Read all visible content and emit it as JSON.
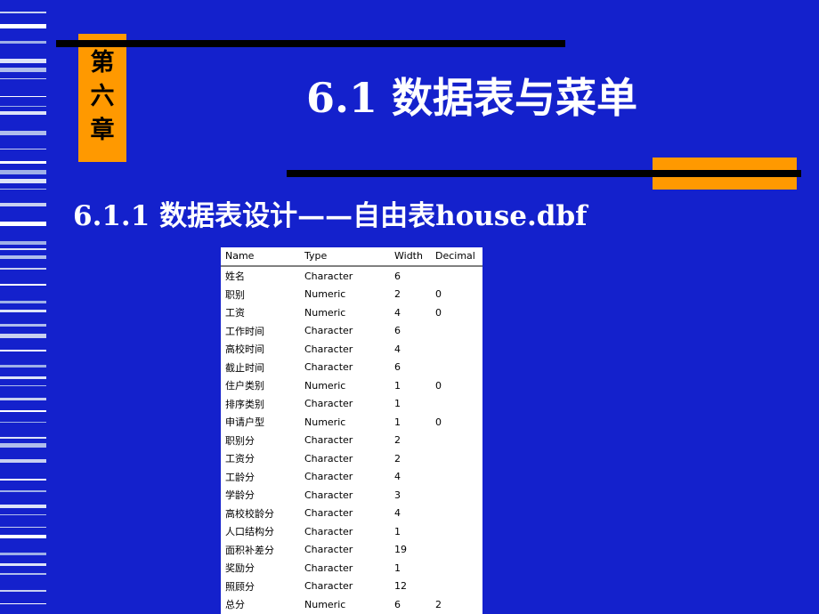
{
  "slide": {
    "chapter_badge": [
      "第",
      "六",
      "章"
    ],
    "title": "6.1 数据表与菜单",
    "subtitle": "6.1.1 数据表设计——自由表house.dbf"
  },
  "colors": {
    "background_blue": "#1421cc",
    "accent_orange": "#ff9900",
    "bar_black": "#000000",
    "table_background": "#ffffff",
    "title_text": "#ffffff"
  },
  "table": {
    "headers": [
      "Name",
      "Type",
      "Width",
      "Decimal"
    ],
    "rows": [
      {
        "name": "姓名",
        "type": "Character",
        "width": "6",
        "decimal": ""
      },
      {
        "name": "职别",
        "type": "Numeric",
        "width": "2",
        "decimal": "0"
      },
      {
        "name": "工资",
        "type": "Numeric",
        "width": "4",
        "decimal": "0"
      },
      {
        "name": "工作时间",
        "type": "Character",
        "width": "6",
        "decimal": ""
      },
      {
        "name": "高校时间",
        "type": "Character",
        "width": "4",
        "decimal": ""
      },
      {
        "name": "截止时间",
        "type": "Character",
        "width": "6",
        "decimal": ""
      },
      {
        "name": "住户类别",
        "type": "Numeric",
        "width": "1",
        "decimal": "0"
      },
      {
        "name": "排序类别",
        "type": "Character",
        "width": "1",
        "decimal": ""
      },
      {
        "name": "申请户型",
        "type": "Numeric",
        "width": "1",
        "decimal": "0"
      },
      {
        "name": "职别分",
        "type": "Character",
        "width": "2",
        "decimal": ""
      },
      {
        "name": "工资分",
        "type": "Character",
        "width": "2",
        "decimal": ""
      },
      {
        "name": "工龄分",
        "type": "Character",
        "width": "4",
        "decimal": ""
      },
      {
        "name": "学龄分",
        "type": "Character",
        "width": "3",
        "decimal": ""
      },
      {
        "name": "高校校龄分",
        "type": "Character",
        "width": "4",
        "decimal": ""
      },
      {
        "name": "人口结构分",
        "type": "Character",
        "width": "1",
        "decimal": ""
      },
      {
        "name": "面积补差分",
        "type": "Character",
        "width": "19",
        "decimal": ""
      },
      {
        "name": "奖励分",
        "type": "Character",
        "width": "1",
        "decimal": ""
      },
      {
        "name": "照顾分",
        "type": "Character",
        "width": "12",
        "decimal": ""
      },
      {
        "name": "总分",
        "type": "Numeric",
        "width": "6",
        "decimal": "2"
      }
    ]
  },
  "decor": {
    "stripe_count": 34
  }
}
